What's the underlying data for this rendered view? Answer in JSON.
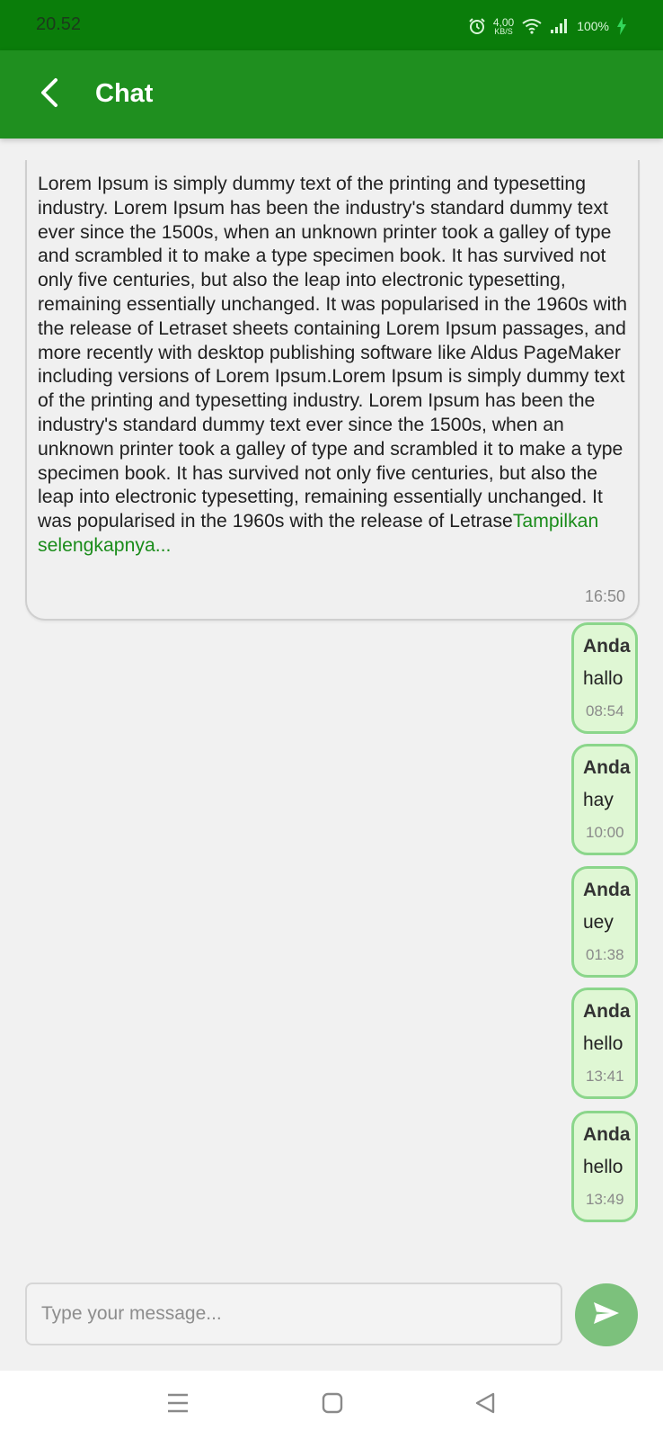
{
  "status_bar": {
    "time": "20.52",
    "speed_value": "4,00",
    "speed_unit": "KB/S",
    "battery": "100%",
    "icons": [
      "alarm-icon",
      "wifi-icon",
      "signal-icon",
      "charging-icon"
    ]
  },
  "app_bar": {
    "title": "Chat",
    "back_icon": "chevron-left-icon"
  },
  "incoming_message": {
    "text": "Lorem Ipsum is simply dummy text of the printing and typesetting industry. Lorem Ipsum has been the industry's standard dummy text ever since the 1500s, when an unknown printer took a galley of type and scrambled it to make a type specimen book. It has survived not only five centuries, but also the leap into electronic typesetting, remaining essentially unchanged. It was popularised in the 1960s with the release of Letraset sheets containing Lorem Ipsum passages, and more recently with desktop publishing software like Aldus PageMaker including versions of Lorem Ipsum.Lorem Ipsum is simply dummy text of the printing and typesetting industry. Lorem Ipsum has been the industry's standard dummy text ever since the 1500s, when an unknown printer took a galley of type and scrambled it to make a type specimen book. It has survived not only five centuries, but also the leap into electronic typesetting, remaining essentially unchanged. It was popularised in the 1960s with the release of Letrase",
    "show_more": "Tampilkan selengkapnya...",
    "time": "16:50"
  },
  "outgoing_messages": [
    {
      "sender": "Anda",
      "text": "hallo",
      "time": "08:54"
    },
    {
      "sender": "Anda",
      "text": "hay",
      "time": "10:00"
    },
    {
      "sender": "Anda",
      "text": "uey",
      "time": "01:38"
    },
    {
      "sender": "Anda",
      "text": "hello",
      "time": "13:41"
    },
    {
      "sender": "Anda",
      "text": "hello",
      "time": "13:49"
    }
  ],
  "composer": {
    "placeholder": "Type your message...",
    "value": "",
    "send_icon": "send-icon"
  },
  "nav_bar": {
    "icons": [
      "recent-apps-icon",
      "home-icon",
      "back-icon"
    ]
  },
  "colors": {
    "status_bar": "#0a7d0a",
    "app_bar": "#1f8f1f",
    "accent": "#1a8c1a",
    "outgoing_bubble": "#dff7d4",
    "outgoing_border": "#8bd68b",
    "send_button": "#7cc17c"
  }
}
